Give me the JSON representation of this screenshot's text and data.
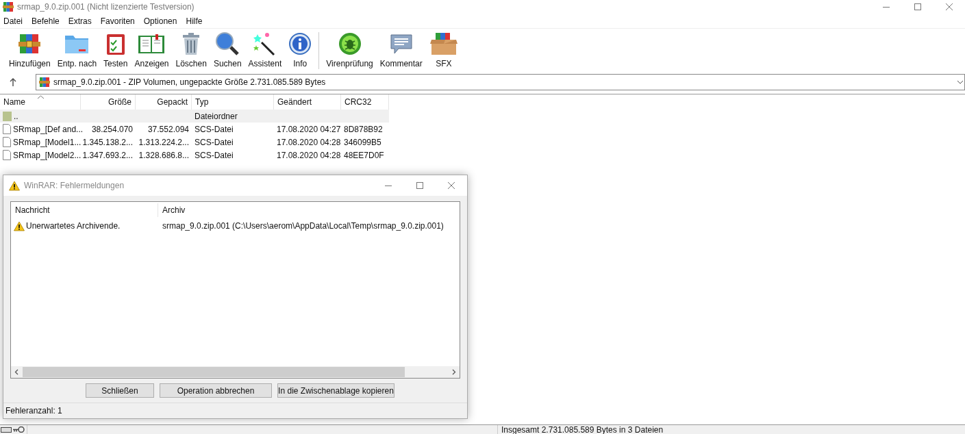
{
  "window": {
    "title": "srmap_9.0.zip.001 (Nicht lizenzierte Testversion)"
  },
  "menu": [
    "Datei",
    "Befehle",
    "Extras",
    "Favoriten",
    "Optionen",
    "Hilfe"
  ],
  "toolbar": {
    "groups": [
      [
        "Hinzufügen",
        "Entp. nach",
        "Testen",
        "Anzeigen",
        "Löschen",
        "Suchen",
        "Assistent",
        "Info"
      ],
      [
        "Virenprüfung",
        "Kommentar",
        "SFX"
      ]
    ]
  },
  "address": {
    "value": "srmap_9.0.zip.001 - ZIP Volumen, ungepackte Größe 2.731.085.589 Bytes"
  },
  "table": {
    "columns": [
      {
        "label": "Name",
        "sorted": true
      },
      {
        "label": "Größe",
        "sorted": false
      },
      {
        "label": "Gepackt",
        "sorted": false
      },
      {
        "label": "Typ",
        "sorted": false
      },
      {
        "label": "Geändert",
        "sorted": false
      },
      {
        "label": "CRC32",
        "sorted": false
      }
    ],
    "rows": [
      {
        "kind": "folder",
        "selected": true,
        "cells": [
          "..",
          "",
          "",
          "Dateiordner",
          "",
          ""
        ]
      },
      {
        "kind": "file",
        "selected": false,
        "cells": [
          "SRmap_[Def and...",
          "38.254.070",
          "37.552.094",
          "SCS-Datei",
          "17.08.2020 04:27",
          "8D878B92"
        ]
      },
      {
        "kind": "file",
        "selected": false,
        "cells": [
          "SRmap_[Model1...",
          "1.345.138.2...",
          "1.313.224.2...",
          "SCS-Datei",
          "17.08.2020 04:28",
          "346099B5"
        ]
      },
      {
        "kind": "file",
        "selected": false,
        "cells": [
          "SRmap_[Model2...",
          "1.347.693.2...",
          "1.328.686.8...",
          "SCS-Datei",
          "17.08.2020 04:28",
          "48EE7D0F"
        ]
      }
    ]
  },
  "dialog": {
    "title": "WinRAR: Fehlermeldungen",
    "columns": [
      "Nachricht",
      "Archiv"
    ],
    "rows": [
      {
        "message": "Unerwartetes Archivende.",
        "archive": "srmap_9.0.zip.001 (C:\\Users\\aerom\\AppData\\Local\\Temp\\srmap_9.0.zip.001)"
      }
    ],
    "buttons": [
      "Schließen",
      "Operation abbrechen",
      "In die Zwischenablage kopieren"
    ],
    "footer": "Fehleranzahl: 1"
  },
  "status_bar": {
    "text": "Insgesamt 2.731.085.589 Bytes in 3 Dateien"
  }
}
